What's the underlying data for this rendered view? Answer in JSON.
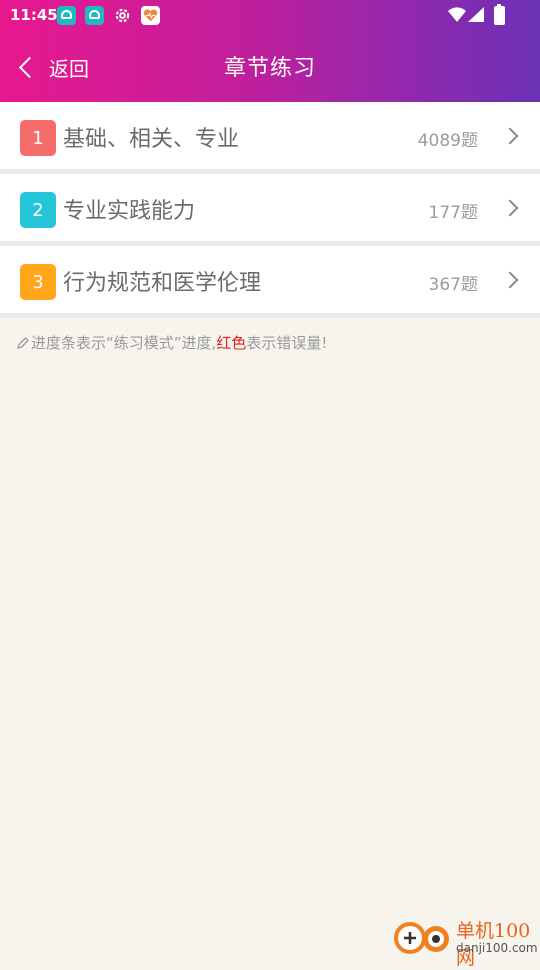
{
  "status": {
    "time": "11:45",
    "icons": [
      "app-icon",
      "app-icon",
      "gear-icon",
      "heart-app-icon",
      "wifi-icon",
      "signal-icon",
      "battery-icon"
    ]
  },
  "nav": {
    "back_label": "返回",
    "title": "章节练习"
  },
  "colors": {
    "header_gradient": [
      "#e8188f",
      "#6b32b5"
    ],
    "badge_red": "#f56c6c",
    "badge_teal": "#26c6da",
    "badge_orange": "#ffa61a",
    "highlight_red": "#e02020"
  },
  "chapters": [
    {
      "index": "1",
      "title": "基础、相关、专业",
      "count": "4089题",
      "color": "#f56c6c"
    },
    {
      "index": "2",
      "title": "专业实践能力",
      "count": "177题",
      "color": "#26c6da"
    },
    {
      "index": "3",
      "title": "行为规范和医学伦理",
      "count": "367题",
      "color": "#ffa61a"
    }
  ],
  "note": {
    "part1": "进度条表示“练习模式”进度,",
    "highlight": "红色",
    "part2": "表示错误量!"
  },
  "watermark": {
    "brand": "单机100网",
    "url": "danji100.com"
  }
}
